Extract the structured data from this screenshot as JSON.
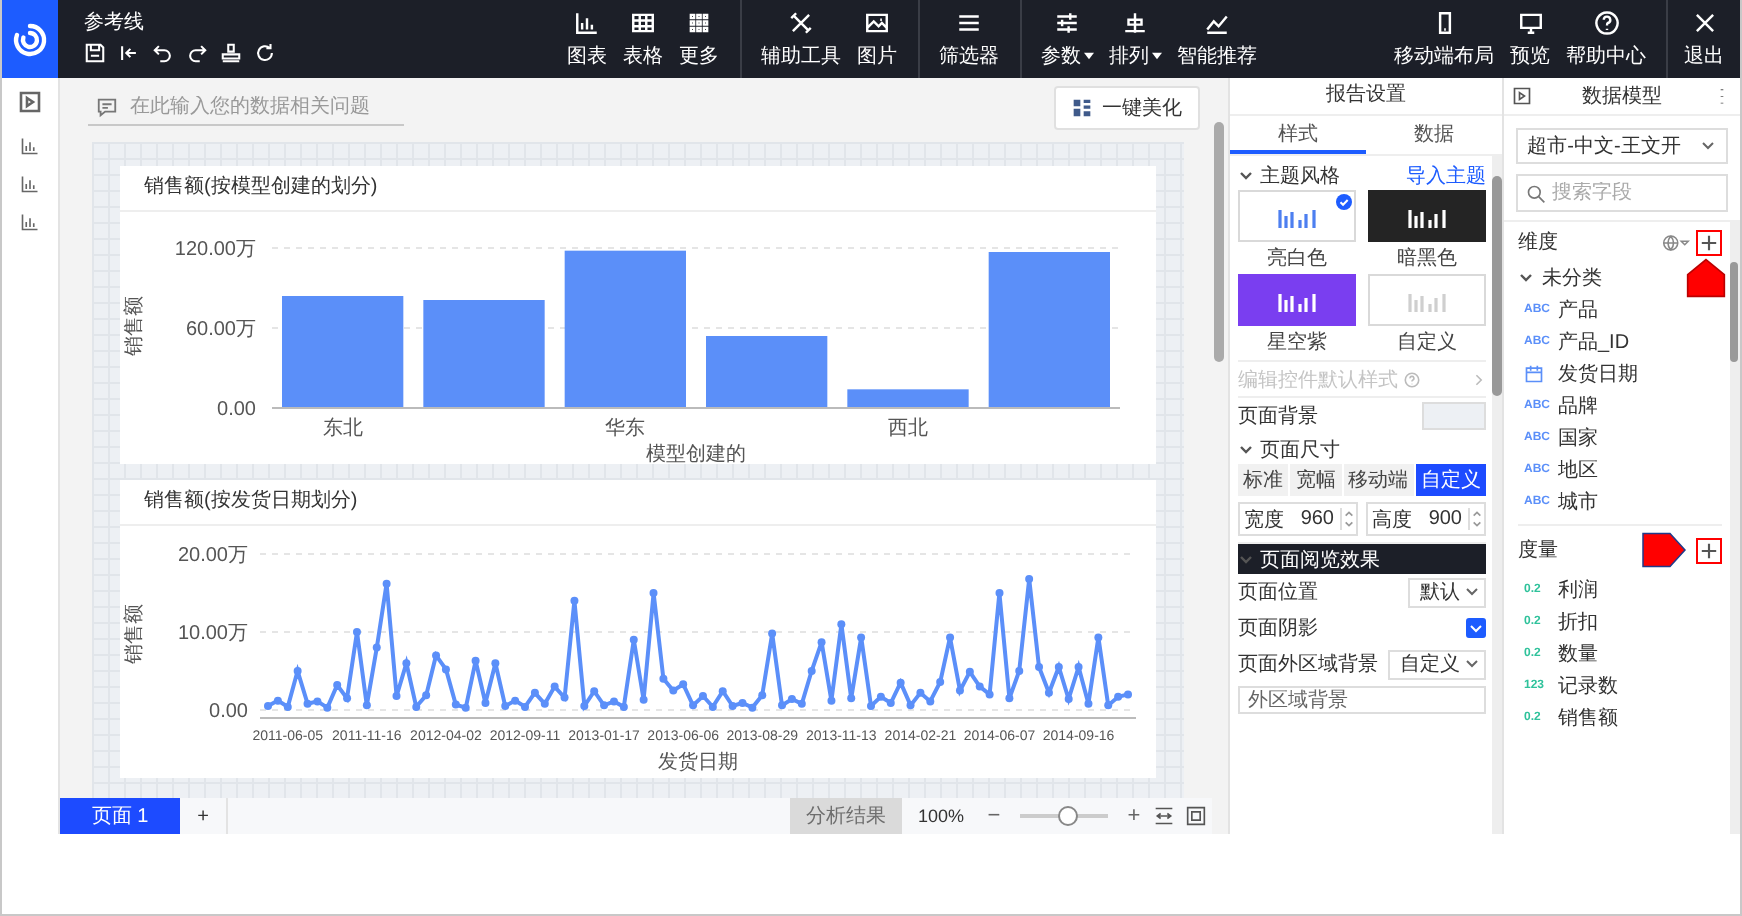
{
  "topbar": {
    "title": "参考线",
    "tool_groups": [
      [
        {
          "label": "图表",
          "dropdown": false
        },
        {
          "label": "表格",
          "dropdown": false
        },
        {
          "label": "更多",
          "dropdown": false
        }
      ],
      [
        {
          "label": "辅助工具",
          "dropdown": false
        },
        {
          "label": "图片",
          "dropdown": false
        }
      ],
      [
        {
          "label": "筛选器",
          "dropdown": false
        }
      ],
      [
        {
          "label": "参数",
          "dropdown": true
        },
        {
          "label": "排列",
          "dropdown": true
        },
        {
          "label": "智能推荐",
          "dropdown": false
        }
      ]
    ],
    "right_buttons": [
      {
        "label": "移动端布局"
      },
      {
        "label": "预览"
      },
      {
        "label": "帮助中心"
      }
    ],
    "exit": {
      "label": "退出"
    }
  },
  "question_bar": {
    "placeholder": "在此输入您的数据相关问题"
  },
  "beautify_button": {
    "label": "一键美化"
  },
  "cards": [
    {
      "title": "销售额(按模型创建的划分)",
      "chart_data": {
        "type": "bar",
        "xlabel": "模型创建的",
        "ylabel": "销售额",
        "categories": [
          "东北",
          null,
          "华东",
          null,
          "西北",
          null
        ],
        "values": [
          84,
          81,
          118,
          54,
          14,
          117
        ],
        "ylim": [
          0,
          120
        ],
        "yticks": [
          {
            "value": 0,
            "label": "0.00"
          },
          {
            "value": 60,
            "label": "60.00万"
          },
          {
            "value": 120,
            "label": "120.00万"
          }
        ]
      }
    },
    {
      "title": "销售额(按发货日期划分)",
      "chart_data": {
        "type": "line",
        "xlabel": "发货日期",
        "ylabel": "销售额",
        "marker": true,
        "ylim": [
          0,
          20
        ],
        "yticks": [
          {
            "value": 0,
            "label": "0.00"
          },
          {
            "value": 10,
            "label": "10.00万"
          },
          {
            "value": 20,
            "label": "20.00万"
          }
        ],
        "categories": [
          null,
          null,
          "2011-06-05",
          null,
          null,
          null,
          null,
          null,
          null,
          null,
          "2011-11-16",
          null,
          null,
          null,
          null,
          null,
          null,
          null,
          "2012-04-02",
          null,
          null,
          null,
          null,
          null,
          null,
          null,
          "2012-09-11",
          null,
          null,
          null,
          null,
          null,
          null,
          null,
          "2013-01-17",
          null,
          null,
          null,
          null,
          null,
          null,
          null,
          "2013-06-06",
          null,
          null,
          null,
          null,
          null,
          null,
          null,
          "2013-08-29",
          null,
          null,
          null,
          null,
          null,
          null,
          null,
          "2013-11-13",
          null,
          null,
          null,
          null,
          null,
          null,
          null,
          "2014-02-21",
          null,
          null,
          null,
          null,
          null,
          null,
          null,
          "2014-06-07",
          null,
          null,
          null,
          null,
          null,
          null,
          null,
          "2014-09-16",
          null,
          null,
          null,
          null,
          null
        ],
        "values": [
          0.5,
          1.2,
          0.4,
          5,
          0.8,
          1.1,
          0.3,
          3.2,
          1.5,
          10,
          0.6,
          8,
          16.2,
          1.8,
          6,
          0.4,
          1.9,
          7,
          5.2,
          0.7,
          0.3,
          6.3,
          0.9,
          6,
          0.5,
          1.2,
          0.4,
          2.2,
          0.8,
          3,
          1.6,
          14,
          0.5,
          2.4,
          0.6,
          1.1,
          0.4,
          9,
          1.3,
          15,
          4,
          2.5,
          3.3,
          0.6,
          1.8,
          0.4,
          2.4,
          0.5,
          0.9,
          0.3,
          1.9,
          9.8,
          0.6,
          1.4,
          0.8,
          5,
          8.7,
          1.2,
          11,
          1.5,
          9.3,
          0.5,
          1.7,
          0.9,
          3.5,
          0.6,
          2.2,
          1.1,
          3.6,
          9.3,
          2.5,
          4.9,
          3,
          2,
          15,
          1.5,
          5,
          16.8,
          5.5,
          2.2,
          5.5,
          1.4,
          5.5,
          0.8,
          9.3,
          0.6,
          1.7,
          2
        ]
      }
    }
  ],
  "page_tabs": [
    {
      "label": "页面 1",
      "selected": true
    }
  ],
  "add_page": "+",
  "analysis_button": {
    "label": "分析结果",
    "disabled": true
  },
  "zoom": {
    "reading": "100%",
    "minus": "−",
    "plus": "+",
    "level": 0.55
  },
  "report_settings": {
    "title": "报告设置",
    "tabs": [
      {
        "label": "样式",
        "selected": true
      },
      {
        "label": "数据",
        "selected": false
      }
    ],
    "theme": {
      "heading": "主题风格",
      "import_link": "导入主题",
      "themes": [
        {
          "label": "亮白色",
          "kind": "light",
          "selected": true
        },
        {
          "label": "暗黑色",
          "kind": "dark",
          "selected": false
        },
        {
          "label": "星空紫",
          "kind": "purple",
          "selected": false
        },
        {
          "label": "自定义",
          "kind": "custom",
          "selected": false
        }
      ]
    },
    "edit_defaults": {
      "label": "编辑控件默认样式",
      "disabled": true
    },
    "page_background": {
      "label": "页面背景"
    },
    "page_size": {
      "heading": "页面尺寸",
      "options": [
        {
          "label": "标准",
          "selected": false
        },
        {
          "label": "宽幅",
          "selected": false
        },
        {
          "label": "移动端",
          "selected": false
        },
        {
          "label": "自定义",
          "selected": true
        }
      ],
      "width": {
        "label": "宽度",
        "value": "960"
      },
      "height": {
        "label": "高度",
        "value": "900"
      }
    },
    "view_effect": {
      "heading": "页面阅览效果",
      "position": {
        "label": "页面位置",
        "value": "默认"
      },
      "shadow": {
        "label": "页面阴影",
        "checked": true
      },
      "outer_bg": {
        "label": "页面外区域背景",
        "value": "自定义"
      },
      "outer_bg_field": {
        "placeholder": "外区域背景"
      }
    }
  },
  "data_model": {
    "title": "数据模型",
    "dataset": "超市-中文-王文开",
    "search": {
      "placeholder": "搜索字段"
    },
    "dimensions": {
      "heading": "维度",
      "folders": [
        {
          "label": "未分类",
          "children": [
            {
              "name": "产品",
              "kind": "text",
              "type_label": "ABC"
            },
            {
              "name": "产品_ID",
              "kind": "text",
              "type_label": "ABC"
            },
            {
              "name": "发货日期",
              "kind": "date"
            },
            {
              "name": "品牌",
              "kind": "text",
              "type_label": "ABC"
            },
            {
              "name": "国家",
              "kind": "text",
              "type_label": "ABC"
            },
            {
              "name": "地区",
              "kind": "text",
              "type_label": "ABC"
            },
            {
              "name": "城市",
              "kind": "text",
              "type_label": "ABC"
            }
          ]
        }
      ]
    },
    "measures": {
      "heading": "度量",
      "fields": [
        {
          "name": "利润",
          "kind": "number",
          "type_label": "0.2"
        },
        {
          "name": "折扣",
          "kind": "number",
          "type_label": "0.2"
        },
        {
          "name": "数量",
          "kind": "number",
          "type_label": "0.2"
        },
        {
          "name": "记录数",
          "kind": "number",
          "type_label": "123"
        },
        {
          "name": "销售额",
          "kind": "number",
          "type_label": "0.2"
        }
      ]
    }
  }
}
